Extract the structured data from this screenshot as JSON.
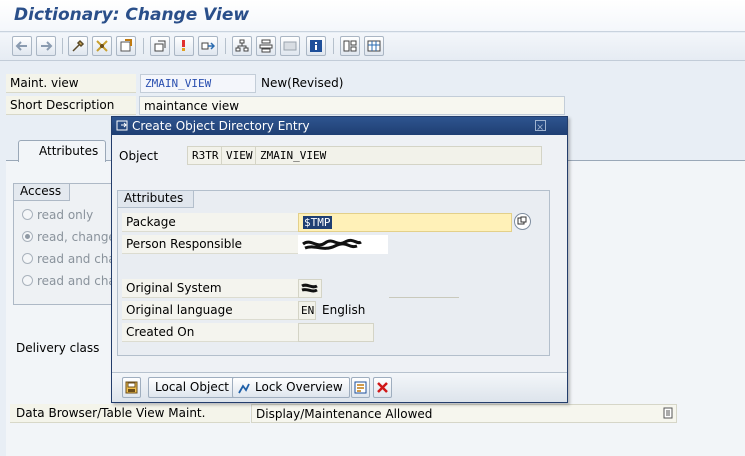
{
  "header": {
    "title": "Dictionary: Change View"
  },
  "toolbar": {
    "buttons": [
      "back-arrow-icon",
      "forward-arrow-icon",
      "tools-icon",
      "other-object-icon",
      "display-change-icon",
      "check-icon",
      "activate-icon",
      "where-used-icon",
      "object-list-icon",
      "hierarchy-icon",
      "display-icon",
      "frame-icon",
      "info-icon",
      "layout-icon",
      "table-icon"
    ]
  },
  "form": {
    "maint_view_label": "Maint. view",
    "maint_view_value": "ZMAIN_VIEW",
    "maint_view_status": "New(Revised)",
    "short_desc_label": "Short Description",
    "short_desc_value": "maintance view"
  },
  "tabs": {
    "attributes": "Attributes"
  },
  "access": {
    "title": "Access",
    "options": [
      {
        "label": "read only",
        "selected": false
      },
      {
        "label": "read, change,",
        "selected": true
      },
      {
        "label": "read and char",
        "selected": false
      },
      {
        "label": "read and char",
        "selected": false
      }
    ]
  },
  "delivery_class_label": "Delivery class",
  "data_browser": {
    "label": "Data Browser/Table View Maint.",
    "value": "Display/Maintenance Allowed"
  },
  "popup": {
    "title": "Create Object Directory Entry",
    "object_label": "Object",
    "object_pgmid": "R3TR",
    "object_type": "VIEW",
    "object_name": "ZMAIN_VIEW",
    "attributes_title": "Attributes",
    "package_label": "Package",
    "package_value": "$TMP",
    "person_label": "Person Responsible",
    "orig_system_label": "Original System",
    "orig_lang_label": "Original language",
    "orig_lang_code": "EN",
    "orig_lang_name": "English",
    "created_on_label": "Created On",
    "buttons": {
      "save_icon": "save-icon",
      "local_object": "Local Object",
      "lock_overview": "Lock Overview",
      "cancel_icon": "cancel-icon"
    }
  },
  "colors": {
    "title_text": "#2a4f8a",
    "popup_titlebar": "#1f3f73",
    "package_field": "#fff1b8",
    "selected_text": "#1f3f73"
  }
}
